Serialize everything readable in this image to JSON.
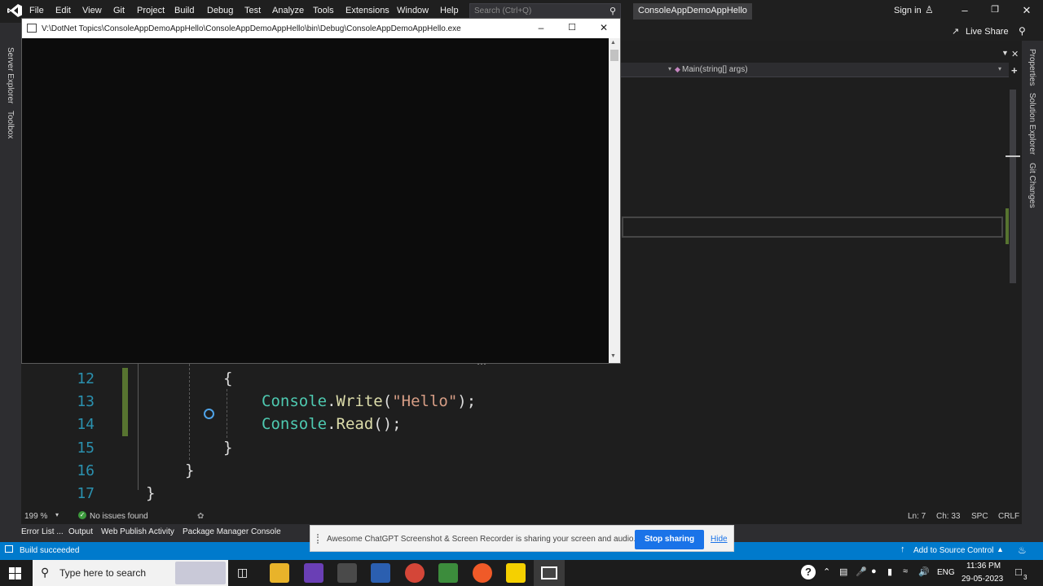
{
  "menubar": {
    "items": [
      "File",
      "Edit",
      "View",
      "Git",
      "Project",
      "Build",
      "Debug",
      "Test",
      "Analyze",
      "Tools",
      "Extensions",
      "Window",
      "Help"
    ],
    "search_placeholder": "Search (Ctrl+Q)",
    "solution_title": "ConsoleAppDemoAppHello",
    "sign_in": "Sign in",
    "live_share": "Live Share"
  },
  "left_strip": [
    "Server Explorer",
    "Toolbox"
  ],
  "right_strip": [
    "Properties",
    "Solution Explorer",
    "Git Changes"
  ],
  "nav_bar": {
    "method": "Main(string[] args)"
  },
  "console": {
    "title": "V:\\DotNet Topics\\ConsoleAppDemoAppHello\\ConsoleAppDemoAppHello\\bin\\Debug\\ConsoleAppDemoAppHello.exe"
  },
  "code": {
    "line_numbers": [
      "12",
      "13",
      "14",
      "15",
      "16",
      "17"
    ],
    "brace_open": "{",
    "brace_close": "}",
    "console_class": "Console",
    "write_method": "Write",
    "hello_string": "\"Hello\"",
    "read_method": "Read",
    "dot": ".",
    "open_paren": "(",
    "close_paren_semi": ");",
    "empty_call": "();"
  },
  "editor_status": {
    "zoom": "199 %",
    "issues": "No issues found",
    "ln": "Ln: 7",
    "ch": "Ch: 33",
    "spc": "SPC",
    "crlf": "CRLF"
  },
  "tool_tabs": [
    "Error List ...",
    "Output",
    "Web Publish Activity",
    "Package Manager Console"
  ],
  "statusbar": {
    "build": "Build succeeded",
    "source_control": "Add to Source Control"
  },
  "share_bar": {
    "message": "Awesome ChatGPT Screenshot & Screen Recorder is sharing your screen and audio.",
    "stop": "Stop sharing",
    "hide": "Hide"
  },
  "taskbar": {
    "search_placeholder": "Type here to search",
    "lang": "ENG",
    "time": "11:36 PM",
    "date": "29-05-2023",
    "notification_count": "3"
  },
  "colors": {
    "accent": "#007acc",
    "editor_bg": "#1e1e1e",
    "type_color": "#4ec9b0",
    "method_color": "#dcdcaa",
    "string_color": "#d69d85",
    "line_number_color": "#2b91af"
  }
}
